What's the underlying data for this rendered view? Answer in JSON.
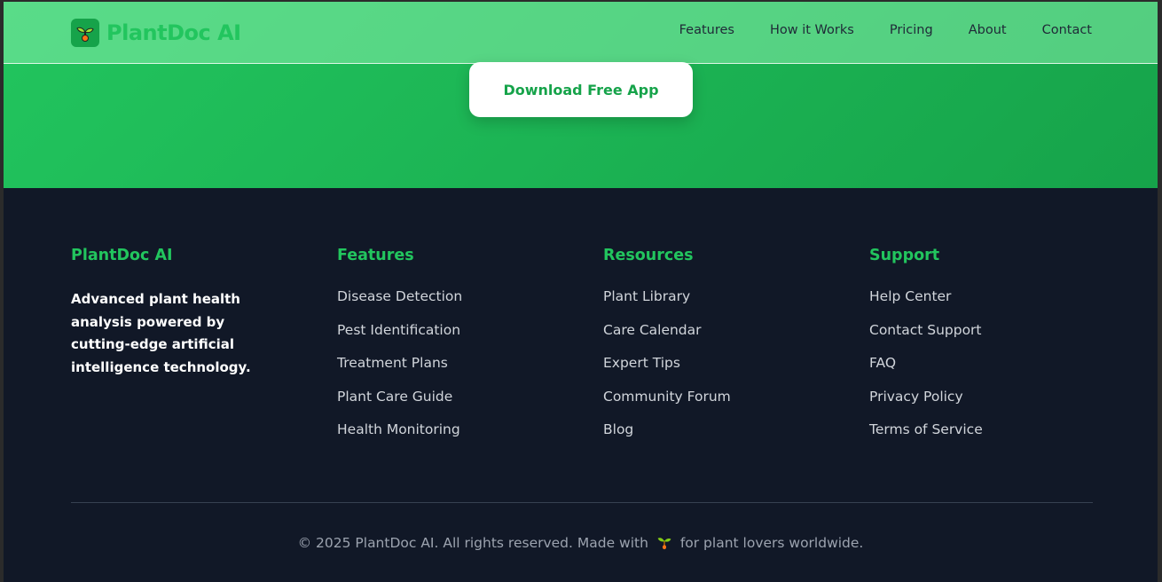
{
  "header": {
    "brand": "PlantDoc AI",
    "nav": [
      "Features",
      "How it Works",
      "Pricing",
      "About",
      "Contact"
    ]
  },
  "hero": {
    "cta": "Download Free App"
  },
  "footer": {
    "about": {
      "title": "PlantDoc AI",
      "text": "Advanced plant health analysis powered by cutting-edge artificial intelligence technology."
    },
    "columns": [
      {
        "title": "Features",
        "links": [
          "Disease Detection",
          "Pest Identification",
          "Treatment Plans",
          "Plant Care Guide",
          "Health Monitoring"
        ]
      },
      {
        "title": "Resources",
        "links": [
          "Plant Library",
          "Care Calendar",
          "Expert Tips",
          "Community Forum",
          "Blog"
        ]
      },
      {
        "title": "Support",
        "links": [
          "Help Center",
          "Contact Support",
          "FAQ",
          "Privacy Policy",
          "Terms of Service"
        ]
      }
    ],
    "copyright_pre": "© 2025 PlantDoc AI. All rights reserved. Made with",
    "copyright_post": "for plant lovers worldwide."
  }
}
